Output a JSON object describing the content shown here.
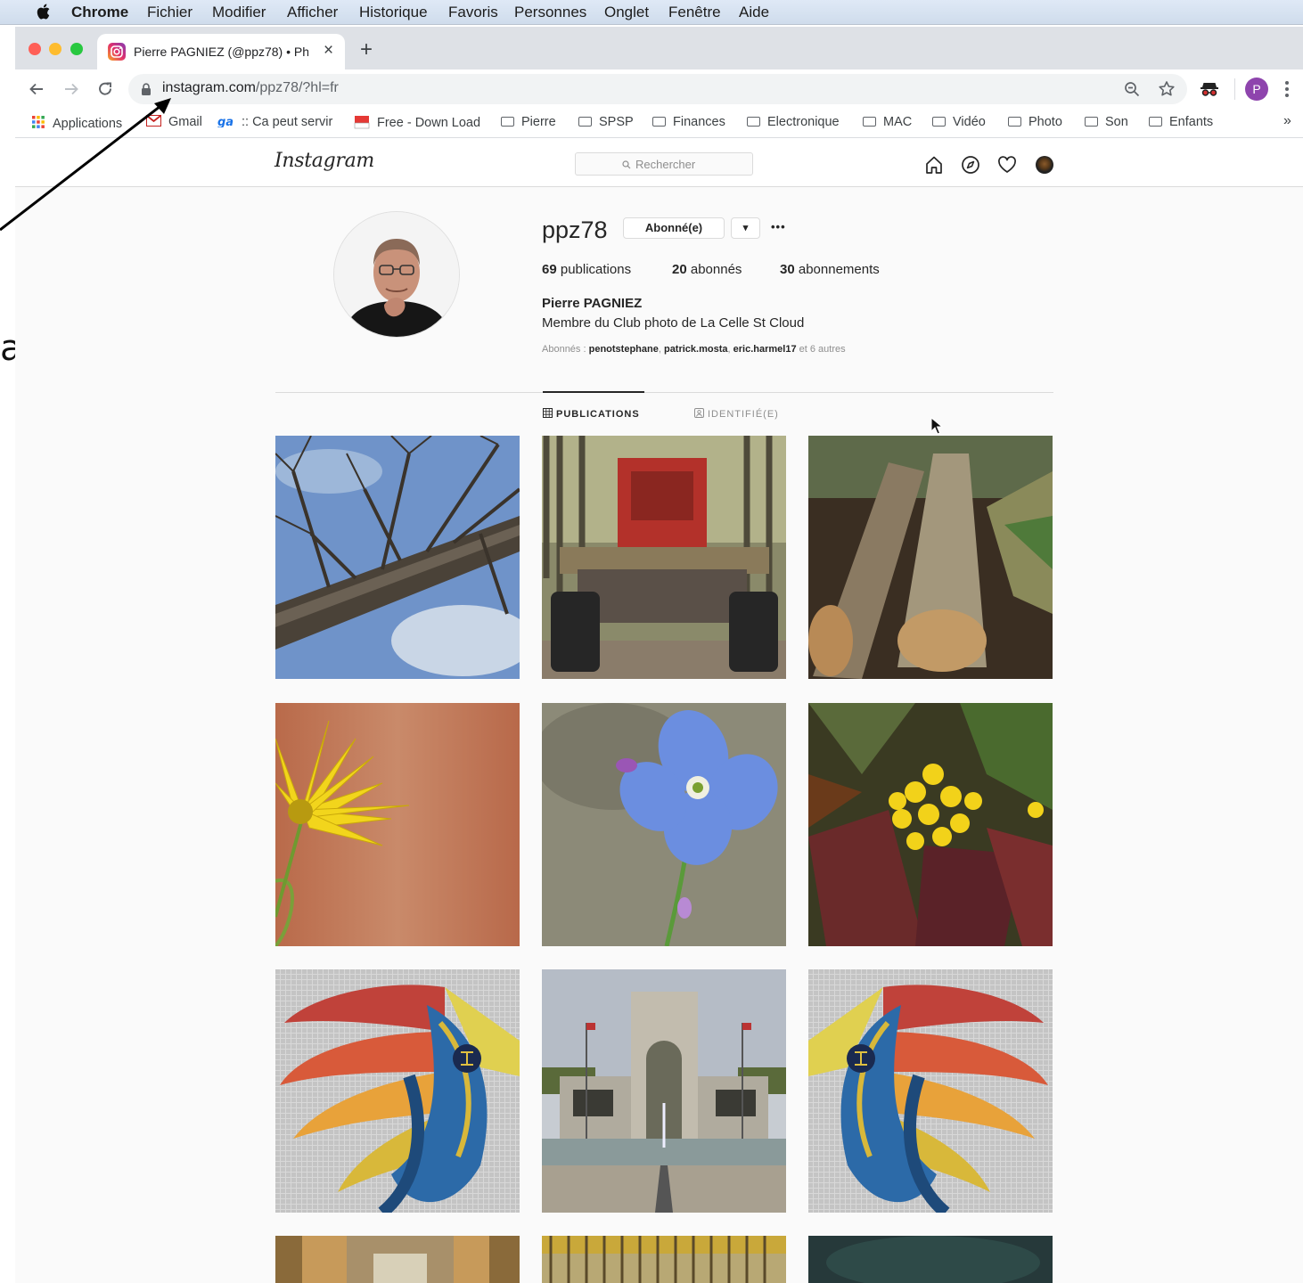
{
  "menubar": {
    "app": "Chrome",
    "items": [
      "Fichier",
      "Modifier",
      "Afficher",
      "Historique",
      "Favoris",
      "Personnes",
      "Onglet",
      "Fenêtre",
      "Aide"
    ]
  },
  "tab": {
    "title": "Pierre PAGNIEZ (@ppz78) • Ph",
    "close": "×",
    "new_tab": "+"
  },
  "address": {
    "domain": "instagram.com",
    "path": "/ppz78/?hl=fr",
    "profile_initial": "P"
  },
  "bookmarks": {
    "items": [
      "Applications",
      "Gmail",
      ":: Ca peut servir",
      "Free - Down Load",
      "Pierre",
      "SPSP",
      "Finances",
      "Electronique",
      "MAC",
      "Vidéo",
      "Photo",
      "Son",
      "Enfants"
    ],
    "more": "»"
  },
  "instagram": {
    "logo": "Instagram",
    "search_placeholder": "Rechercher"
  },
  "profile": {
    "username": "ppz78",
    "follow_button": "Abonné(e)",
    "dropdown": "▾",
    "more": "•••",
    "posts_count": "69",
    "posts_label": "publications",
    "followers_count": "20",
    "followers_label": "abonnés",
    "following_count": "30",
    "following_label": "abonnements",
    "full_name": "Pierre PAGNIEZ",
    "bio": "Membre du Club photo de La Celle St Cloud",
    "followed_prefix": "Abonnés :",
    "followed_by": [
      "penotstephane",
      "patrick.mosta",
      "eric.harmel17"
    ],
    "followed_suffix": "et 6 autres"
  },
  "tabs": {
    "publications": "PUBLICATIONS",
    "tagged": "IDENTIFIÉ(E)"
  },
  "annotation": {
    "text": "agram"
  }
}
